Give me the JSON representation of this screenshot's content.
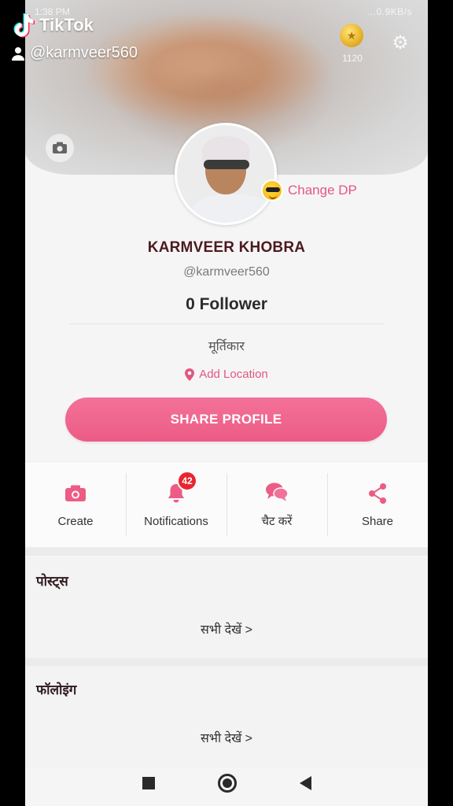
{
  "status": {
    "time": "1:38 PM",
    "network": "...0.9KB/s"
  },
  "wallet": {
    "coins": "1120"
  },
  "profile": {
    "change_dp": "Change DP",
    "name": "KARMVEER KHOBRA",
    "handle": "@karmveer560",
    "followers": "0 Follower",
    "bio": "मूर्तिकार",
    "location": "Add Location",
    "share_button": "SHARE PROFILE"
  },
  "actions": [
    {
      "label": "Create",
      "icon": "camera-icon"
    },
    {
      "label": "Notifications",
      "icon": "bell-icon",
      "badge": "42"
    },
    {
      "label": "चैट करें",
      "icon": "chat-icon"
    },
    {
      "label": "Share",
      "icon": "share-icon"
    }
  ],
  "sections": {
    "posts": {
      "title": "पोस्ट्स",
      "see_all": "सभी देखें >"
    },
    "following": {
      "title": "फॉलोइंग",
      "see_all": "सभी देखें >"
    }
  },
  "watermark": {
    "brand": "TikTok",
    "user": "@karmveer560"
  },
  "colors": {
    "accent": "#ec5c85",
    "badge": "#e8262f"
  }
}
